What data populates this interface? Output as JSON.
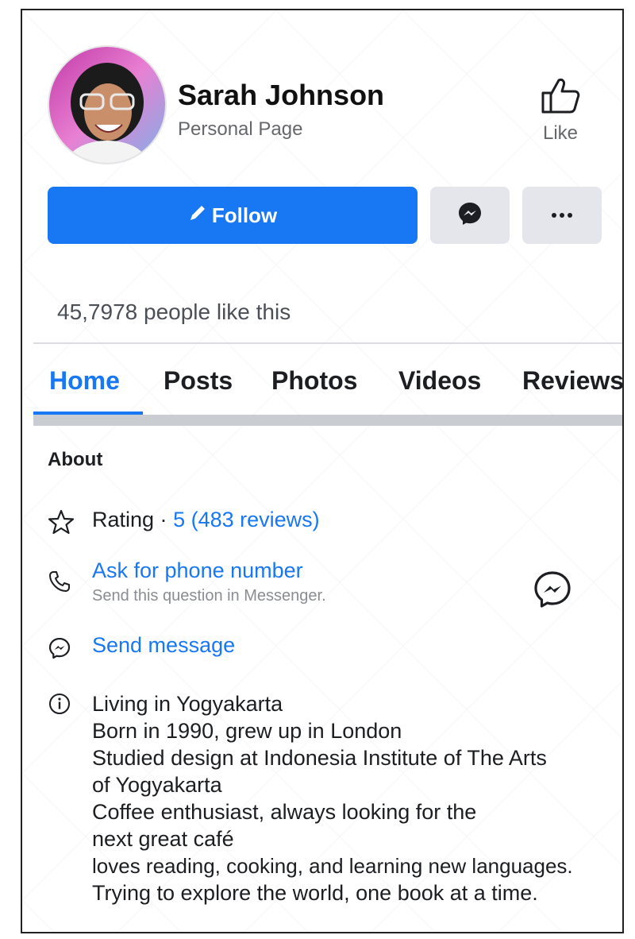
{
  "profile": {
    "name": "Sarah Johnson",
    "subtitle": "Personal Page",
    "like_label": "Like"
  },
  "actions": {
    "follow_label": "Follow"
  },
  "stats": {
    "likes_text": "45,7978 people like this"
  },
  "tabs": [
    {
      "label": "Home",
      "active": true
    },
    {
      "label": "Posts"
    },
    {
      "label": "Photos"
    },
    {
      "label": "Videos"
    },
    {
      "label": "Reviews"
    }
  ],
  "about": {
    "heading": "About",
    "rating_label": "Rating ·",
    "rating_value": "5 (483 reviews)",
    "phone_link": "Ask for phone number",
    "phone_sub": "Send this question in Messenger.",
    "send_message": "Send message",
    "bio_lines": [
      "Living in Yogyakarta",
      "Born in 1990, grew up in London",
      "Studied design at Indonesia Institute of The Arts",
      "of Yogyakarta",
      "Coffee enthusiast, always looking for the",
      "next great café",
      "loves reading, cooking, and learning new languages.",
      "Trying to explore the world, one book at a time."
    ]
  },
  "colors": {
    "accent": "#1877f2",
    "secondary_button": "#e4e6eb",
    "text_muted": "#65676b"
  },
  "icons": [
    "thumbs-up-icon",
    "pencil-icon",
    "messenger-icon",
    "more-icon",
    "star-icon",
    "phone-icon",
    "info-icon"
  ]
}
